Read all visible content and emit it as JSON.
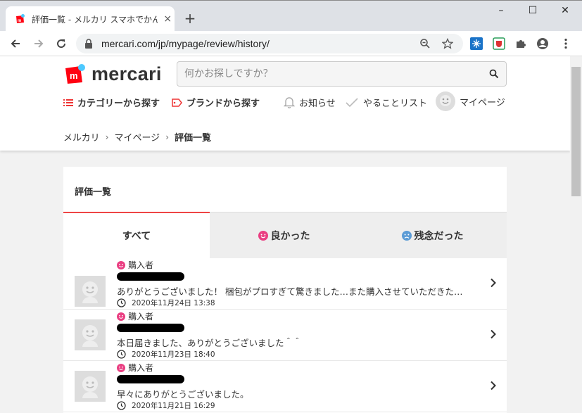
{
  "browser": {
    "tab_title": "評価一覧 - メルカリ スマホでかんたん フリマアプリ",
    "tab_close": "×",
    "new_tab": "+",
    "url": "mercari.com/jp/mypage/review/history/",
    "window_controls": [
      "–",
      "☐",
      "✕"
    ]
  },
  "header": {
    "logo_text": "mercari",
    "search_placeholder": "何かお探しですか？",
    "nav": {
      "category": "カテゴリーから探す",
      "brand": "ブランドから探す",
      "notifications": "お知らせ",
      "todo": "やることリスト",
      "mypage": "マイページ"
    }
  },
  "breadcrumb": [
    "メルカリ",
    "マイページ",
    "評価一覧"
  ],
  "card": {
    "title": "評価一覧",
    "tabs": [
      "すべて",
      "良かった",
      "残念だった"
    ],
    "reviews": [
      {
        "role": "購入者",
        "comment": "ありがとうございました！ 梱包がプロすぎて驚きました…また購入させていただきた…",
        "date": "2020年11月24日 13:38"
      },
      {
        "role": "購入者",
        "comment": "本日届きました、ありがとうございました＾＾",
        "date": "2020年11月23日 18:40"
      },
      {
        "role": "購入者",
        "comment": "早々にありがとうございました。",
        "date": "2020年11月21日 16:29"
      }
    ]
  },
  "colors": {
    "brand_red": "#ff0211",
    "good_face": "#ea3f82",
    "bad_face": "#5b9bd5",
    "tab_active_border": "#e44444"
  }
}
